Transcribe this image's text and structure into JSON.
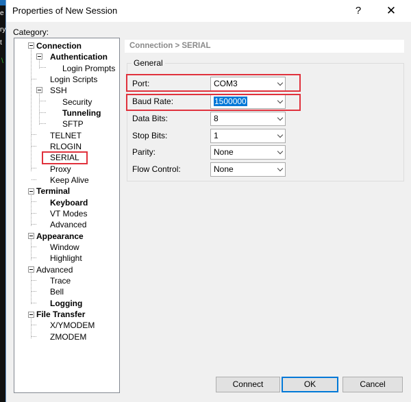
{
  "window": {
    "title": "Properties of New Session",
    "help_glyph": "?",
    "close_glyph": "✕"
  },
  "category_label": "Category:",
  "tree": [
    {
      "label": "Connection",
      "bold": true
    },
    {
      "label": "Authentication",
      "bold": true
    },
    {
      "label": "Login Prompts",
      "bold": false
    },
    {
      "label": "Login Scripts",
      "bold": false
    },
    {
      "label": "SSH",
      "bold": false
    },
    {
      "label": "Security",
      "bold": false
    },
    {
      "label": "Tunneling",
      "bold": true
    },
    {
      "label": "SFTP",
      "bold": false
    },
    {
      "label": "TELNET",
      "bold": false
    },
    {
      "label": "RLOGIN",
      "bold": false
    },
    {
      "label": "SERIAL",
      "bold": false,
      "selected": true
    },
    {
      "label": "Proxy",
      "bold": false
    },
    {
      "label": "Keep Alive",
      "bold": false
    },
    {
      "label": "Terminal",
      "bold": true
    },
    {
      "label": "Keyboard",
      "bold": true
    },
    {
      "label": "VT Modes",
      "bold": false
    },
    {
      "label": "Advanced",
      "bold": false
    },
    {
      "label": "Appearance",
      "bold": true
    },
    {
      "label": "Window",
      "bold": false
    },
    {
      "label": "Highlight",
      "bold": false
    },
    {
      "label": "Advanced",
      "bold": false
    },
    {
      "label": "Trace",
      "bold": false
    },
    {
      "label": "Bell",
      "bold": false
    },
    {
      "label": "Logging",
      "bold": true
    },
    {
      "label": "File Transfer",
      "bold": true
    },
    {
      "label": "X/YMODEM",
      "bold": false
    },
    {
      "label": "ZMODEM",
      "bold": false
    }
  ],
  "breadcrumb": "Connection > SERIAL",
  "group_title": "General",
  "fields": [
    {
      "label": "Port:",
      "value": "COM3"
    },
    {
      "label": "Baud Rate:",
      "value": "1500000",
      "selected_text": true
    },
    {
      "label": "Data Bits:",
      "value": "8"
    },
    {
      "label": "Stop Bits:",
      "value": "1"
    },
    {
      "label": "Parity:",
      "value": "None"
    },
    {
      "label": "Flow Control:",
      "value": "None"
    }
  ],
  "buttons": {
    "connect": "Connect",
    "ok": "OK",
    "cancel": "Cancel"
  },
  "colors": {
    "highlight_box": "#e0313c",
    "selection": "#0078d7"
  }
}
